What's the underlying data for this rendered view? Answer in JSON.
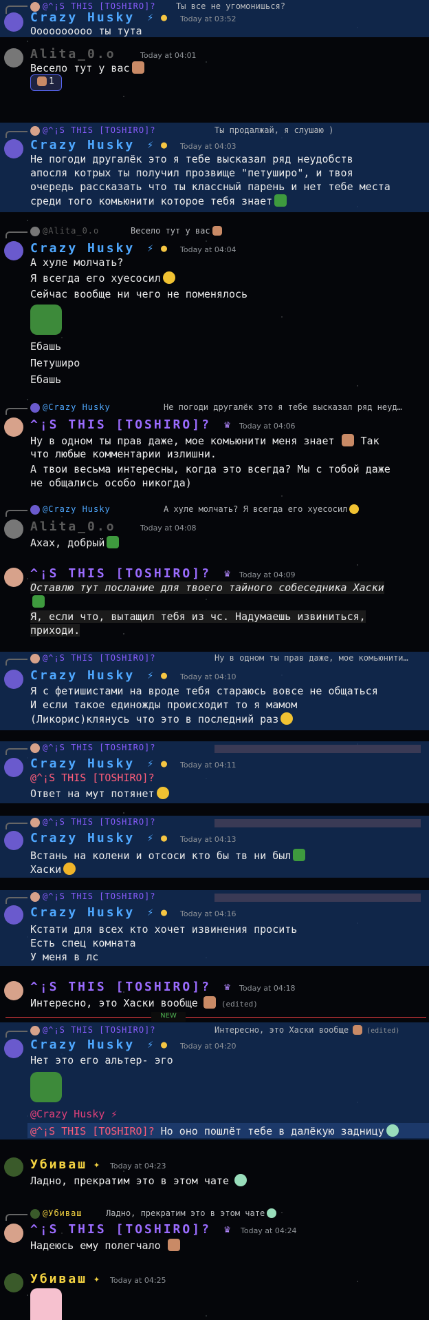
{
  "colors": {
    "husky": "#4fa8ff",
    "toshiro": "#9b6cff",
    "alita": "#5a5a5a",
    "ubivash": "#f5d442",
    "mention": "#ff5d7a"
  },
  "users": {
    "husky": "Crazy Husky",
    "toshiro": "^¡S THIS [TOSHIRO]?",
    "alita": "Alita_0.o",
    "ubivash": "Убиваш",
    "at_husky": "@Crazy Husky",
    "at_toshiro": "@^¡S THIS [TOSHIRO]?",
    "at_alita": "@Alita_0.o",
    "at_ubivash": "@Убиваш"
  },
  "messages": [
    {
      "reply": "Ты все не угомонишься?",
      "time": "Today at 03:52",
      "lines": [
        "Оооооооооо ты тута"
      ]
    },
    {
      "time": "Today at 04:01",
      "lines": [
        "Весело тут у вас"
      ],
      "reaction_count": "1"
    },
    {
      "reply": "Ты продалжай, я слушаю )",
      "time": "Today at 04:03",
      "lines": [
        "Не погоди другалёк это я тебе высказал ряд неудобств",
        "апосля котрых ты получил прозвище \"петуширо\", и твоя",
        "очередь рассказать что ты классный парень и нет тебе места",
        "среди того комьюнити которое тебя знает"
      ]
    },
    {
      "reply": "Весело тут у вас",
      "time": "Today at 04:04",
      "lines": [
        "А хуле молчать?",
        "Я всегда его хуесосил",
        "Сейчас вообще ни чего не поменялось",
        "Ебашь",
        "Петуширо",
        "Ебашь"
      ]
    },
    {
      "reply": "Не погоди другалёк это я тебе высказал ряд неуд…",
      "time": "Today at 04:06",
      "lines": [
        "Ну в одном ты прав даже, мое комьюнити меня знает",
        "Так",
        "что любые комментарии излишни.",
        "А твои весьма интересны, когда это всегда? Мы с тобой даже",
        "не общались особо никогда)"
      ]
    },
    {
      "reply": "А хуле молчать? Я всегда его хуесосил",
      "time": "Today at 04:08",
      "lines": [
        "Ахах, добрый"
      ]
    },
    {
      "time": "Today at 04:09",
      "lines": [
        "Оставлю тут послание для твоего тайного собеседника Хаски",
        "Я, если что, вытащил тебя из чс. Надумаешь извиниться,",
        "приходи."
      ]
    },
    {
      "reply": "Ну в одном ты прав даже, мое комьюнити…",
      "time": "Today at 04:10",
      "lines": [
        "Я с фетишистами на вроде тебя стараюсь вовсе не общаться",
        "И если такое единожды происходит то я мамом",
        "(Ликорис)клянусь что это в последний раз"
      ]
    },
    {
      "time": "Today at 04:11",
      "lines": [
        "Ответ на мут потянет"
      ]
    },
    {
      "time": "Today at 04:13",
      "lines": [
        "Встань на колени и отсоси кто бы тв ни был",
        "Хаски"
      ]
    },
    {
      "time": "Today at 04:16",
      "lines": [
        "Кстати для всех кто хочет извинения просить",
        "Есть спец комната",
        "У меня в лс"
      ]
    },
    {
      "time": "Today at 04:18",
      "lines": [
        "Интересно, это Хаски вообще"
      ],
      "edited": "(edited)"
    },
    {
      "new_label": "NEW",
      "reply": "Интересно, это Хаски вообще",
      "time": "Today at 04:20",
      "lines": [
        "Нет это его альтер- эго",
        "Но оно пошлёт тебе в далёкую задницу"
      ]
    },
    {
      "time": "Today at 04:23",
      "lines": [
        "Ладно, прекратим это в этом чате"
      ]
    },
    {
      "reply": "Ладно, прекратим это в этом чате",
      "time": "Today at 04:24",
      "lines": [
        "Надеюсь ему полегчало"
      ]
    },
    {
      "time": "Today at 04:25"
    }
  ]
}
